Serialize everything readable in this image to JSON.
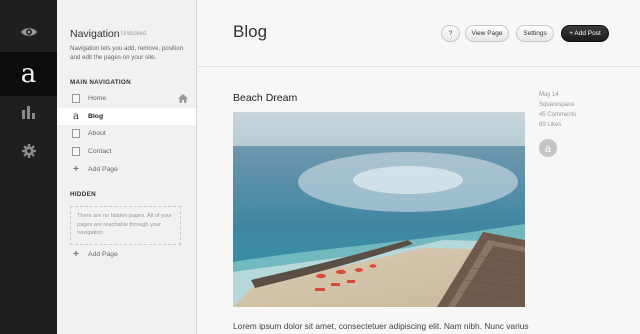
{
  "rail": {
    "items": [
      {
        "icon": "eye-icon"
      },
      {
        "icon": "squarespace-logo-icon",
        "glyph": "a"
      },
      {
        "icon": "bar-chart-icon"
      },
      {
        "icon": "gear-icon"
      }
    ]
  },
  "navigation": {
    "title": "Navigation",
    "badge": "Unlocked",
    "description": "Navigation lets you add, remove, position and edit the pages on your site.",
    "main_heading": "MAIN NAVIGATION",
    "items": [
      {
        "label": "Home",
        "icon": "page-icon"
      },
      {
        "label": "Blog",
        "icon": "blog-logo-icon"
      },
      {
        "label": "About",
        "icon": "page-icon"
      },
      {
        "label": "Contact",
        "icon": "page-icon"
      },
      {
        "label": "Add Page",
        "icon": "plus-icon"
      }
    ],
    "hidden_heading": "HIDDEN",
    "hidden_empty_text": "There are no hidden pages. All of your pages are reachable through your navigation.",
    "hidden_add_label": "Add Page"
  },
  "main": {
    "title": "Blog",
    "toolbar": {
      "help": "?",
      "view_page": "View Page",
      "settings": "Settings",
      "add_post": "+ Add Post"
    },
    "post": {
      "title": "Beach Dream",
      "date": "May 14",
      "author": "Squarespace",
      "comments": "45 Comments",
      "likes": "89 Likes",
      "avatar_letter": "a",
      "excerpt": "Lorem ipsum dolor sit amet, consectetuer adipiscing elit. Nam nibh. Nunc varius"
    }
  },
  "colors": {
    "rail_bg": "#1f1f1f",
    "nav_bg": "#f1f1f1",
    "add_post_bg": "#222222"
  }
}
